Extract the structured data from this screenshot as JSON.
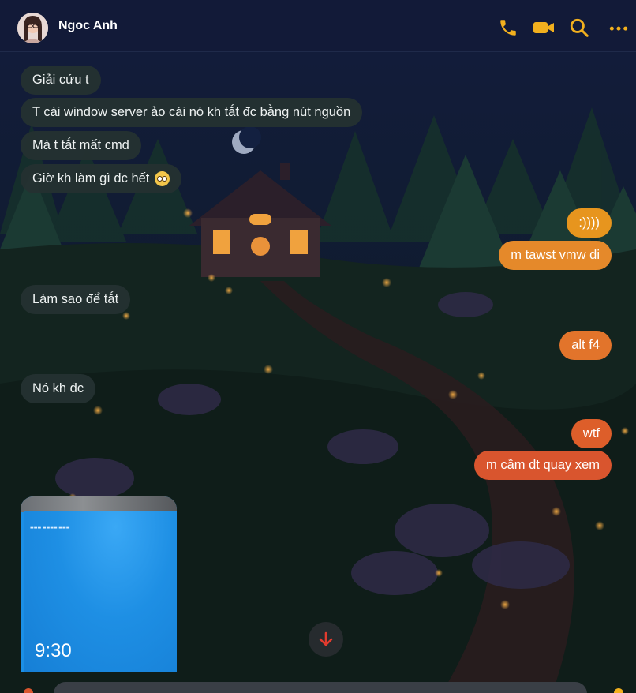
{
  "header": {
    "contact_name": "Ngoc Anh",
    "avatar_icon": "avatar-photo",
    "actions": [
      {
        "name": "phone-icon"
      },
      {
        "name": "video-camera-icon"
      },
      {
        "name": "search-icon"
      },
      {
        "name": "more-options-icon"
      }
    ]
  },
  "theme": {
    "accent": "#f2b01e",
    "incoming_bubble": "#243131",
    "outgoing_gradient": [
      "#e7951e",
      "#d9552e"
    ]
  },
  "messages": [
    {
      "direction": "incoming",
      "text": "Giải cứu t"
    },
    {
      "direction": "incoming",
      "text": "T cài window server ảo cái nó kh tắt đc bằng nút nguồn"
    },
    {
      "direction": "incoming",
      "text": "Mà t tắt mất cmd"
    },
    {
      "direction": "incoming",
      "text": "Giờ kh làm gì đc hết",
      "emoji": "flushed-face-icon"
    },
    {
      "direction": "outgoing",
      "text": ":))))"
    },
    {
      "direction": "outgoing",
      "text": "m tawst vmw di"
    },
    {
      "direction": "incoming",
      "text": "Làm sao để tắt"
    },
    {
      "direction": "outgoing",
      "text": "alt f4"
    },
    {
      "direction": "incoming",
      "text": "Nó kh đc"
    },
    {
      "direction": "outgoing",
      "text": "wtf"
    },
    {
      "direction": "outgoing",
      "text": "m cầm dt quay xem"
    }
  ],
  "attachment": {
    "type": "photo",
    "clock_text": "9:30"
  },
  "scroll_button": {
    "icon": "arrow-down-icon"
  },
  "composer": {
    "placeholder": ""
  }
}
